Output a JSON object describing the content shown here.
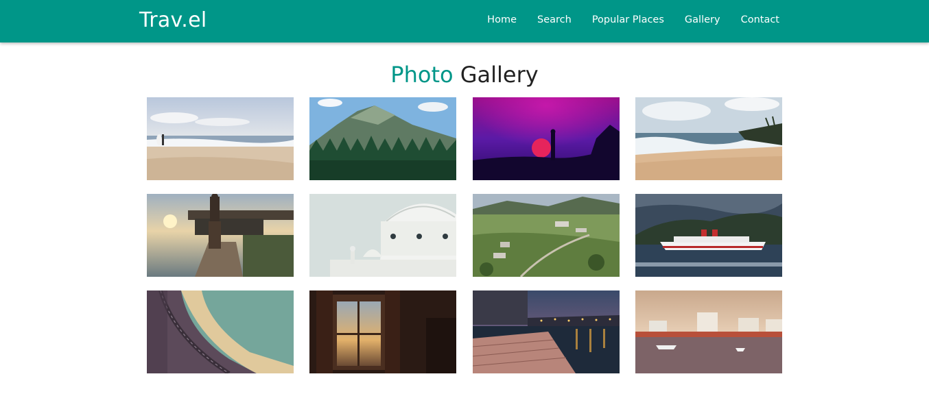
{
  "header": {
    "brand": "Trav.el",
    "nav": [
      {
        "label": "Home"
      },
      {
        "label": "Search"
      },
      {
        "label": "Popular Places"
      },
      {
        "label": "Gallery"
      },
      {
        "label": "Contact"
      }
    ]
  },
  "gallery": {
    "title_accent": "Photo",
    "title_rest": "Gallery",
    "photos": [
      {
        "name": "beach-surfer-photo"
      },
      {
        "name": "mountain-forest-photo"
      },
      {
        "name": "purple-sunset-silhouette-photo"
      },
      {
        "name": "tropical-beach-waves-photo"
      },
      {
        "name": "pier-sunset-photo"
      },
      {
        "name": "white-mosque-photo"
      },
      {
        "name": "valley-town-aerial-photo"
      },
      {
        "name": "cruise-ship-photo"
      },
      {
        "name": "coastal-road-aerial-photo"
      },
      {
        "name": "window-sunset-photo"
      },
      {
        "name": "night-harbor-boardwalk-photo"
      },
      {
        "name": "seaside-town-boats-photo"
      }
    ]
  },
  "colors": {
    "primary": "#009688",
    "white": "#ffffff",
    "text": "#222222"
  }
}
